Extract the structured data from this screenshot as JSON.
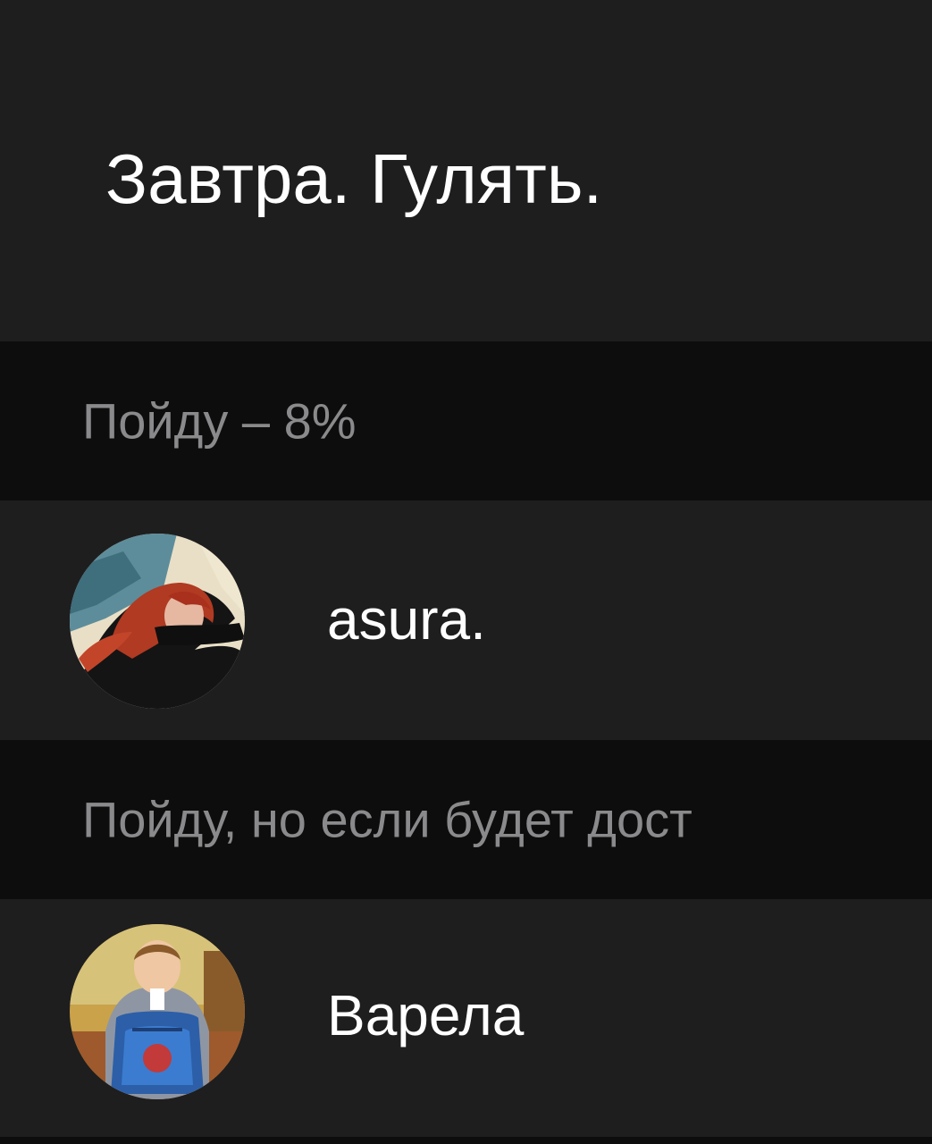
{
  "poll": {
    "question": "Завтра. Гулять."
  },
  "sections": [
    {
      "title": "Пойду – 8%",
      "voters": [
        {
          "name": "asura.",
          "avatar": "avatar-red-hair-painting"
        }
      ]
    },
    {
      "title": "Пойду, но если будет дост",
      "voters": [
        {
          "name": "Варела",
          "avatar": "avatar-boy-with-backpack"
        }
      ]
    }
  ],
  "colors": {
    "background": "#1e1e1f",
    "section_header_bg": "#0d0d0d",
    "text_primary": "#ffffff",
    "text_secondary": "#8a8a8c"
  }
}
